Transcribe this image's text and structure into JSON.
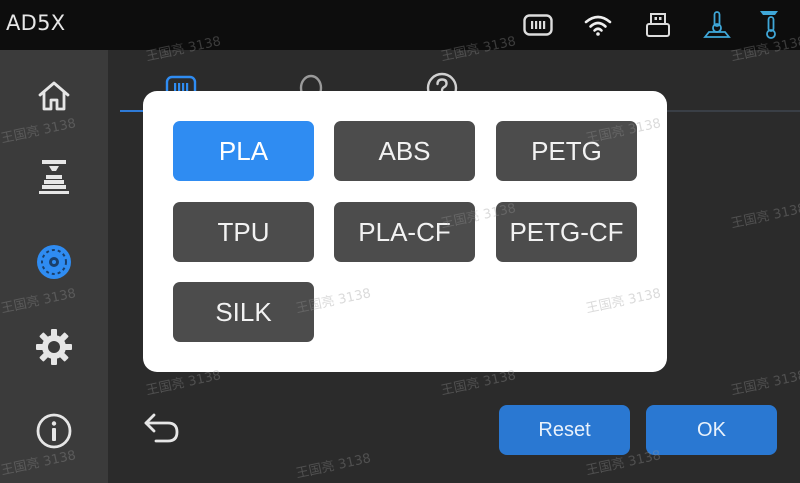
{
  "topbar": {
    "device_name": "AD5X",
    "icons": [
      "filament-spool-status-icon",
      "wifi-icon",
      "usb-icon",
      "nozzle-temperature-icon",
      "bed-temperature-icon"
    ]
  },
  "sidebar": {
    "items": [
      {
        "name": "home",
        "icon": "home-icon"
      },
      {
        "name": "print",
        "icon": "printer-nozzle-icon"
      },
      {
        "name": "filament",
        "icon": "filament-spool-icon",
        "active": true
      },
      {
        "name": "settings",
        "icon": "gear-icon"
      },
      {
        "name": "about",
        "icon": "info-icon"
      }
    ]
  },
  "tabs": [
    {
      "icon": "material-station-icon",
      "active": true
    },
    {
      "icon": "spool-icon"
    },
    {
      "icon": "help-icon"
    }
  ],
  "actions": {
    "reset_label": "Reset",
    "ok_label": "OK"
  },
  "material_dialog": {
    "options": [
      {
        "label": "PLA",
        "selected": true
      },
      {
        "label": "ABS"
      },
      {
        "label": "PETG"
      },
      {
        "label": "TPU"
      },
      {
        "label": "PLA-CF"
      },
      {
        "label": "PETG-CF"
      },
      {
        "label": "SILK"
      }
    ]
  },
  "watermark": "王国亮 3138",
  "colors": {
    "accent": "#2f8cf2",
    "button_blue": "#2a78d2",
    "material_button": "#4c4c4c",
    "dialog_bg": "#ffffff"
  }
}
